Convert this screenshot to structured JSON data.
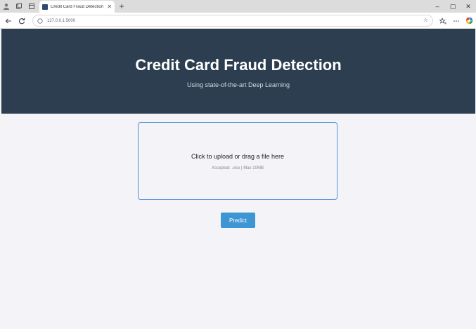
{
  "browser": {
    "tab_title": "Credit Card Fraud Detection",
    "new_tab_symbol": "+",
    "tab_close_symbol": "✕",
    "url": "127.0.0.1:5000",
    "window_controls": {
      "minimize": "–",
      "maximize": "▢",
      "close": "✕"
    }
  },
  "hero": {
    "title": "Credit Card Fraud Detection",
    "subtitle": "Using state-of-the-art Deep Learning",
    "background_color": "#2c3e50"
  },
  "upload": {
    "prompt": "Click to upload or drag a file here",
    "hint": "Accepted: .xlsx | Max 10MB",
    "border_color": "#4f90d6"
  },
  "actions": {
    "predict_label": "Predict",
    "predict_color": "#3d95d4"
  },
  "icons": {
    "profile": "profile-icon",
    "workspaces": "workspaces-icon",
    "tab_actions": "tab-actions-icon",
    "back": "back-arrow-icon",
    "refresh": "refresh-icon",
    "site_info": "site-info-icon",
    "favorite": "favorite-star-icon",
    "favorites": "favorites-icon",
    "menu": "more-menu-icon",
    "copilot": "copilot-icon"
  }
}
